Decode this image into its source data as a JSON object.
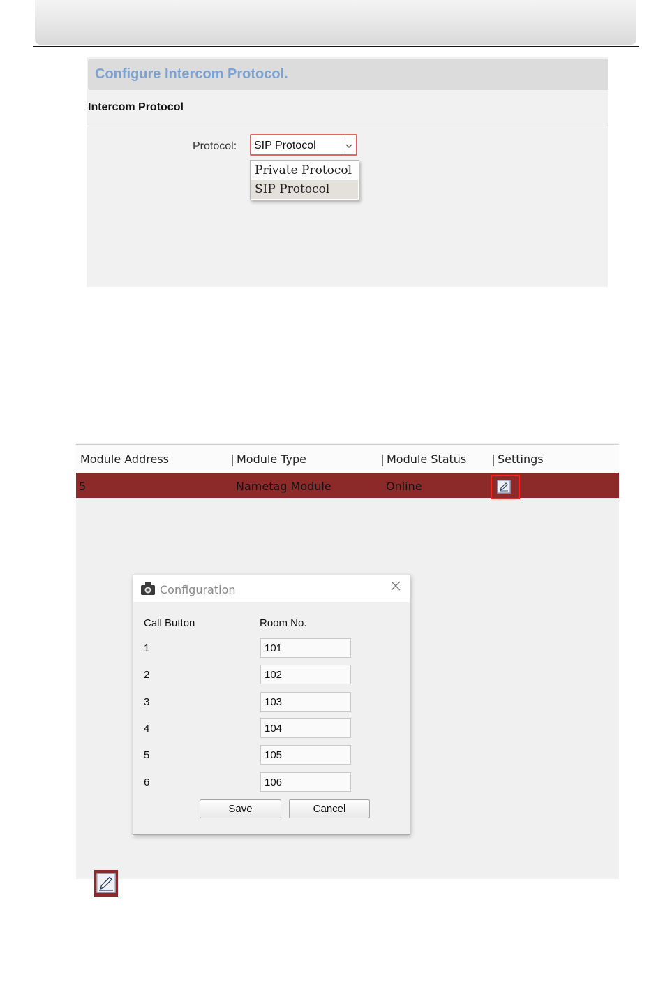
{
  "protocol_config": {
    "title": "Configure Intercom Protocol.",
    "section_title": "Intercom Protocol",
    "protocol_label": "Protocol:",
    "protocol_selected": "SIP Protocol",
    "protocol_options": [
      "Private Protocol",
      "SIP Protocol"
    ]
  },
  "module_table": {
    "columns": [
      "Module Address",
      "Module Type",
      "Module Status",
      "Settings"
    ],
    "rows": [
      {
        "address": "5",
        "type": "Nametag Module",
        "status": "Online",
        "settings_icon": "edit-icon"
      }
    ]
  },
  "config_dialog": {
    "title": "Configuration",
    "col_call_button": "Call Button",
    "col_room_no": "Room No.",
    "rows": [
      {
        "button": "1",
        "room": "101"
      },
      {
        "button": "2",
        "room": "102"
      },
      {
        "button": "3",
        "room": "103"
      },
      {
        "button": "4",
        "room": "104"
      },
      {
        "button": "5",
        "room": "105"
      },
      {
        "button": "6",
        "room": "106"
      }
    ],
    "save_label": "Save",
    "cancel_label": "Cancel"
  },
  "colors": {
    "title_blue": "#7aa3d3",
    "selected_row": "#8c2a2a",
    "highlight_red": "#ff2020"
  },
  "icons": [
    "edit-icon",
    "close-icon",
    "chevron-down-icon",
    "camera-app-icon"
  ]
}
